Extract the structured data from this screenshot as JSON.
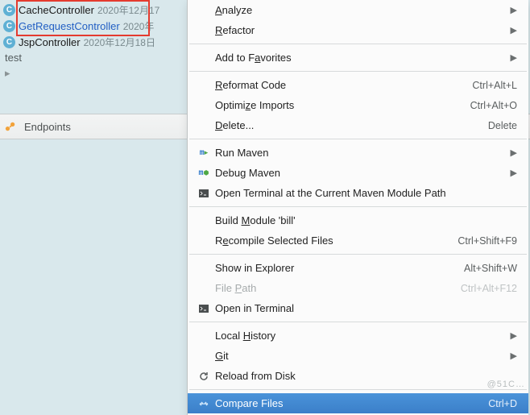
{
  "files": [
    {
      "name": "CacheController",
      "date": "2020年12月17",
      "link": false
    },
    {
      "name": "GetRequestController",
      "date": "2020年",
      "link": true
    },
    {
      "name": "JspController",
      "date": "2020年12月18日",
      "link": false
    }
  ],
  "misc_label": "test",
  "toolbar": {
    "endpoints_label": "Endpoints"
  },
  "menu": {
    "analyze": "Analyze",
    "refactor": "Refactor",
    "add_favorites_pre": "Add to F",
    "add_favorites_mn": "a",
    "add_favorites_post": "vorites",
    "reformat_pre": "",
    "reformat_mn": "R",
    "reformat_post": "eformat Code",
    "reformat_sc": "Ctrl+Alt+L",
    "optimize_pre": "Optimi",
    "optimize_mn": "z",
    "optimize_post": "e Imports",
    "optimize_sc": "Ctrl+Alt+O",
    "delete_pre": "",
    "delete_mn": "D",
    "delete_post": "elete...",
    "delete_sc": "Delete",
    "run_maven": "Run Maven",
    "debug_maven": "Debug Maven",
    "open_terminal_maven": "Open Terminal at the Current Maven Module Path",
    "build_module_pre": "Build ",
    "build_module_mn": "M",
    "build_module_post": "odule 'bill'",
    "recompile_pre": "R",
    "recompile_mn": "e",
    "recompile_post": "compile Selected Files",
    "recompile_sc": "Ctrl+Shift+F9",
    "show_explorer": "Show in Explorer",
    "show_explorer_sc": "Alt+Shift+W",
    "file_path_pre": "File ",
    "file_path_mn": "P",
    "file_path_post": "ath",
    "file_path_sc": "Ctrl+Alt+F12",
    "open_terminal": "Open in Terminal",
    "local_history_pre": "Local ",
    "local_history_mn": "H",
    "local_history_post": "istory",
    "git_pre": "",
    "git_mn": "G",
    "git_post": "it",
    "reload_disk": "Reload from Disk",
    "compare_files": "Compare Files",
    "compare_files_sc": "Ctrl+D"
  },
  "watermark": "@51C…"
}
